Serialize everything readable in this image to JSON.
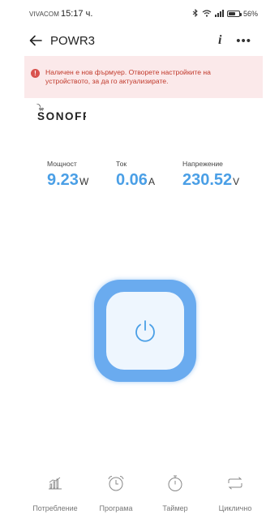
{
  "status_bar": {
    "carrier": "VIVACOM",
    "time": "15:17 ч.",
    "battery_percent": "56%",
    "battery_level": 0.56,
    "icons": [
      "bluetooth-icon",
      "wifi-icon",
      "signal-icon",
      "battery-icon"
    ]
  },
  "header": {
    "back_icon": "arrow-left-icon",
    "title": "POWR3",
    "info_label": "i",
    "more_label": "•••"
  },
  "banner": {
    "icon": "alert-icon",
    "icon_label": "!",
    "text": "Наличен е нов фърмуер. Отворете настройките на устройството, за да го актуализирате.",
    "color": "#c0392b",
    "background": "#fbe9ea"
  },
  "brand": {
    "logo": "SONOFF"
  },
  "metrics": {
    "power": {
      "label": "Мощност",
      "value": "9.23",
      "unit": "W"
    },
    "current": {
      "label": "Ток",
      "value": "0.06",
      "unit": "A"
    },
    "voltage": {
      "label": "Напрежение",
      "value": "230.52",
      "unit": "V"
    },
    "value_color": "#4a9fe6"
  },
  "power_button": {
    "icon": "power-icon",
    "state": "off",
    "accent": "#6aabef"
  },
  "tabs": [
    {
      "label": "Потребление",
      "icon": "bar-chart-icon"
    },
    {
      "label": "Програма",
      "icon": "alarm-clock-icon"
    },
    {
      "label": "Таймер",
      "icon": "stopwatch-icon"
    },
    {
      "label": "Циклично",
      "icon": "loop-icon"
    }
  ]
}
